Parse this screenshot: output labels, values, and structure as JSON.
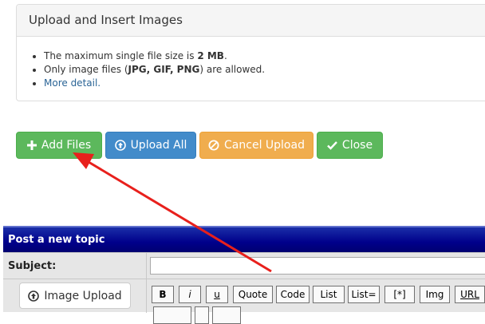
{
  "panel": {
    "title": "Upload and Insert Images",
    "rules": {
      "size_prefix": "The maximum single file size is ",
      "size_value": "2 MB",
      "size_suffix": ".",
      "types_prefix": "Only image files (",
      "types_value": "JPG, GIF, PNG",
      "types_suffix": ") are allowed.",
      "more_link": "More detail."
    }
  },
  "buttons": {
    "add_files": "Add Files",
    "upload_all": "Upload All",
    "cancel_upload": "Cancel Upload",
    "close": "Close"
  },
  "colors": {
    "success": "#5cb85c",
    "primary": "#428bca",
    "warning": "#f0ad4e",
    "annotation_arrow": "#e8201c",
    "forum_header": "#00008b"
  },
  "post": {
    "header": "Post a new topic",
    "subject_label": "Subject:",
    "subject_value": "",
    "image_upload_label": "Image Upload",
    "bbcode": {
      "bold": "B",
      "italic": "i",
      "underline": "u",
      "quote": "Quote",
      "code": "Code",
      "list": "List",
      "list_eq": "List=",
      "list_item": "[*]",
      "img": "Img",
      "url": "URL"
    }
  }
}
